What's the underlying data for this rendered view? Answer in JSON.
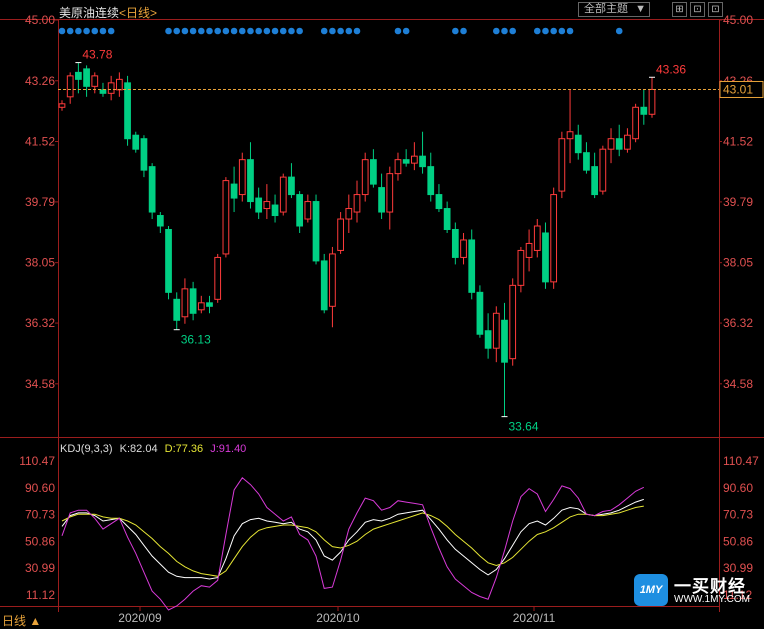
{
  "header": {
    "instrument": "美原油连续",
    "period_text": "<日线>",
    "theme_button": "全部主题",
    "theme_icon": "dropdown-triangle",
    "window_buttons": [
      "⊞",
      "⊡"
    ]
  },
  "colors": {
    "up": "#ff3b3b",
    "down": "#00d084",
    "axis": "#9b1d1d",
    "label": "#e05050",
    "dots": "#1e7fd6",
    "k_line": "#ffffff",
    "d_line": "#e6e635",
    "j_line": "#d83ad8",
    "last_price": "#e8a33a"
  },
  "price_axis": {
    "labels": [
      "45.00",
      "43.26",
      "41.52",
      "39.79",
      "38.05",
      "36.32",
      "34.58"
    ],
    "current_price": "43.01"
  },
  "annotations": {
    "high_left": "43.78",
    "low_left": "36.13",
    "low_right": "33.64",
    "last_high": "43.36"
  },
  "kdj": {
    "legend_name": "KDJ(9,3,3)",
    "k_label": "K:82.04",
    "d_label": "D:77.36",
    "j_label": "J:91.40",
    "axis_labels": [
      "110.47",
      "90.60",
      "70.73",
      "50.86",
      "30.99",
      "11.12"
    ]
  },
  "x_axis": {
    "labels": [
      "2020/09",
      "2020/10",
      "2020/11"
    ]
  },
  "footer": {
    "period_button": "日线 ▲"
  },
  "brand": {
    "logo_text": "1MY",
    "name": "一买财经",
    "url": "WWW.1MY.COM"
  },
  "chart_data": [
    {
      "type": "candlestick",
      "title": "美原油连续 <日线>",
      "ylim": [
        33.2,
        45.0
      ],
      "y_ticks": [
        45.0,
        43.26,
        41.52,
        39.79,
        38.05,
        36.32,
        34.58
      ],
      "x_ticks": [
        "2020/09",
        "2020/10",
        "2020/11"
      ],
      "last_price": 43.01,
      "ohlc": [
        [
          42.5,
          42.7,
          42.4,
          42.6
        ],
        [
          42.8,
          43.5,
          42.6,
          43.4
        ],
        [
          43.5,
          43.78,
          42.9,
          43.3
        ],
        [
          43.6,
          43.7,
          42.8,
          43.1
        ],
        [
          43.1,
          43.5,
          42.9,
          43.4
        ],
        [
          43.0,
          43.2,
          42.8,
          42.9
        ],
        [
          42.9,
          43.4,
          42.7,
          43.2
        ],
        [
          43.0,
          43.5,
          42.8,
          43.3
        ],
        [
          43.2,
          43.4,
          41.4,
          41.6
        ],
        [
          41.7,
          41.8,
          41.2,
          41.3
        ],
        [
          41.6,
          41.7,
          40.5,
          40.7
        ],
        [
          40.8,
          40.9,
          39.3,
          39.5
        ],
        [
          39.4,
          39.5,
          38.9,
          39.1
        ],
        [
          39.0,
          39.1,
          37.0,
          37.2
        ],
        [
          37.0,
          37.2,
          36.13,
          36.4
        ],
        [
          36.5,
          37.6,
          36.3,
          37.3
        ],
        [
          37.3,
          37.5,
          36.4,
          36.6
        ],
        [
          36.7,
          37.1,
          36.6,
          36.9
        ],
        [
          36.9,
          37.1,
          36.6,
          36.8
        ],
        [
          37.0,
          38.3,
          36.9,
          38.2
        ],
        [
          38.3,
          40.5,
          38.2,
          40.4
        ],
        [
          40.3,
          40.8,
          39.5,
          39.9
        ],
        [
          40.0,
          41.2,
          39.8,
          41.0
        ],
        [
          41.0,
          41.5,
          39.6,
          39.8
        ],
        [
          39.9,
          40.2,
          39.3,
          39.5
        ],
        [
          39.6,
          40.3,
          39.3,
          39.8
        ],
        [
          39.7,
          40.0,
          39.2,
          39.4
        ],
        [
          39.5,
          40.6,
          39.4,
          40.5
        ],
        [
          40.5,
          40.9,
          39.9,
          40.0
        ],
        [
          40.0,
          40.1,
          38.9,
          39.1
        ],
        [
          39.3,
          40.0,
          39.2,
          39.8
        ],
        [
          39.8,
          40.0,
          38.0,
          38.1
        ],
        [
          38.1,
          38.3,
          36.6,
          36.7
        ],
        [
          36.8,
          38.5,
          36.2,
          38.3
        ],
        [
          38.4,
          39.5,
          38.3,
          39.3
        ],
        [
          39.3,
          40.0,
          38.9,
          39.6
        ],
        [
          39.5,
          40.4,
          39.2,
          40.0
        ],
        [
          40.0,
          41.2,
          39.8,
          41.0
        ],
        [
          41.0,
          41.3,
          40.2,
          40.3
        ],
        [
          40.2,
          40.6,
          39.3,
          39.5
        ],
        [
          39.5,
          40.8,
          39.0,
          40.6
        ],
        [
          40.6,
          41.2,
          40.4,
          41.0
        ],
        [
          41.0,
          41.3,
          40.8,
          40.9
        ],
        [
          40.9,
          41.5,
          40.7,
          41.1
        ],
        [
          41.1,
          41.8,
          40.6,
          40.8
        ],
        [
          40.8,
          41.2,
          39.8,
          40.0
        ],
        [
          40.0,
          40.3,
          39.5,
          39.6
        ],
        [
          39.6,
          39.8,
          38.9,
          39.0
        ],
        [
          39.0,
          39.2,
          38.0,
          38.2
        ],
        [
          38.2,
          38.9,
          38.0,
          38.7
        ],
        [
          38.7,
          39.0,
          37.0,
          37.2
        ],
        [
          37.2,
          37.4,
          35.9,
          36.0
        ],
        [
          36.1,
          36.6,
          35.3,
          35.6
        ],
        [
          35.6,
          36.8,
          35.2,
          36.6
        ],
        [
          36.4,
          36.9,
          33.64,
          35.2
        ],
        [
          35.3,
          37.6,
          35.1,
          37.4
        ],
        [
          37.4,
          38.5,
          37.2,
          38.4
        ],
        [
          38.2,
          39.0,
          37.8,
          38.6
        ],
        [
          38.4,
          39.3,
          38.2,
          39.1
        ],
        [
          38.9,
          39.2,
          37.3,
          37.5
        ],
        [
          37.5,
          40.2,
          37.3,
          40.0
        ],
        [
          40.1,
          41.8,
          39.9,
          41.6
        ],
        [
          41.6,
          43.0,
          40.9,
          41.8
        ],
        [
          41.7,
          42.0,
          41.0,
          41.2
        ],
        [
          41.2,
          41.5,
          40.6,
          40.7
        ],
        [
          40.8,
          41.2,
          39.9,
          40.0
        ],
        [
          40.1,
          41.4,
          40.0,
          41.3
        ],
        [
          41.3,
          41.9,
          40.9,
          41.6
        ],
        [
          41.6,
          42.0,
          41.1,
          41.3
        ],
        [
          41.3,
          41.9,
          41.2,
          41.7
        ],
        [
          41.6,
          42.6,
          41.5,
          42.5
        ],
        [
          42.5,
          43.0,
          42.0,
          42.3
        ],
        [
          42.3,
          43.36,
          42.2,
          43.01
        ]
      ]
    },
    {
      "type": "line",
      "title": "KDJ(9,3,3)",
      "ylim": [
        0,
        110.47
      ],
      "y_ticks": [
        110.47,
        90.6,
        70.73,
        50.86,
        30.99,
        11.12
      ],
      "series": [
        {
          "name": "K",
          "values": [
            62,
            70,
            72,
            72,
            70,
            66,
            67,
            68,
            62,
            56,
            48,
            40,
            34,
            28,
            25,
            24,
            24,
            24,
            23,
            24,
            38,
            55,
            64,
            67,
            68,
            66,
            65,
            64,
            65,
            60,
            58,
            52,
            40,
            37,
            43,
            52,
            58,
            65,
            67,
            66,
            68,
            71,
            72,
            73,
            74,
            67,
            60,
            52,
            45,
            40,
            35,
            30,
            26,
            30,
            38,
            48,
            58,
            64,
            66,
            63,
            68,
            74,
            76,
            75,
            71,
            70,
            71,
            72,
            74,
            77,
            80,
            82
          ]
        },
        {
          "name": "D",
          "values": [
            66,
            69,
            71,
            71,
            71,
            69,
            68,
            68,
            66,
            63,
            58,
            53,
            47,
            42,
            36,
            32,
            29,
            27,
            26,
            25,
            29,
            38,
            47,
            54,
            59,
            61,
            62,
            63,
            63,
            62,
            61,
            58,
            52,
            47,
            46,
            48,
            51,
            56,
            60,
            62,
            64,
            66,
            68,
            70,
            72,
            70,
            67,
            62,
            56,
            51,
            46,
            40,
            35,
            33,
            35,
            39,
            45,
            51,
            56,
            58,
            61,
            65,
            69,
            71,
            71,
            70,
            70,
            71,
            72,
            74,
            76,
            77
          ]
        },
        {
          "name": "J",
          "values": [
            55,
            72,
            74,
            74,
            68,
            60,
            64,
            68,
            54,
            42,
            28,
            14,
            8,
            0,
            3,
            8,
            14,
            18,
            17,
            22,
            56,
            89,
            98,
            93,
            86,
            76,
            71,
            66,
            69,
            56,
            52,
            40,
            16,
            17,
            37,
            60,
            72,
            83,
            81,
            74,
            76,
            81,
            80,
            79,
            78,
            61,
            46,
            32,
            23,
            18,
            13,
            10,
            8,
            24,
            44,
            66,
            84,
            90,
            86,
            73,
            82,
            92,
            90,
            83,
            71,
            70,
            73,
            74,
            78,
            83,
            88,
            91
          ]
        }
      ]
    }
  ]
}
